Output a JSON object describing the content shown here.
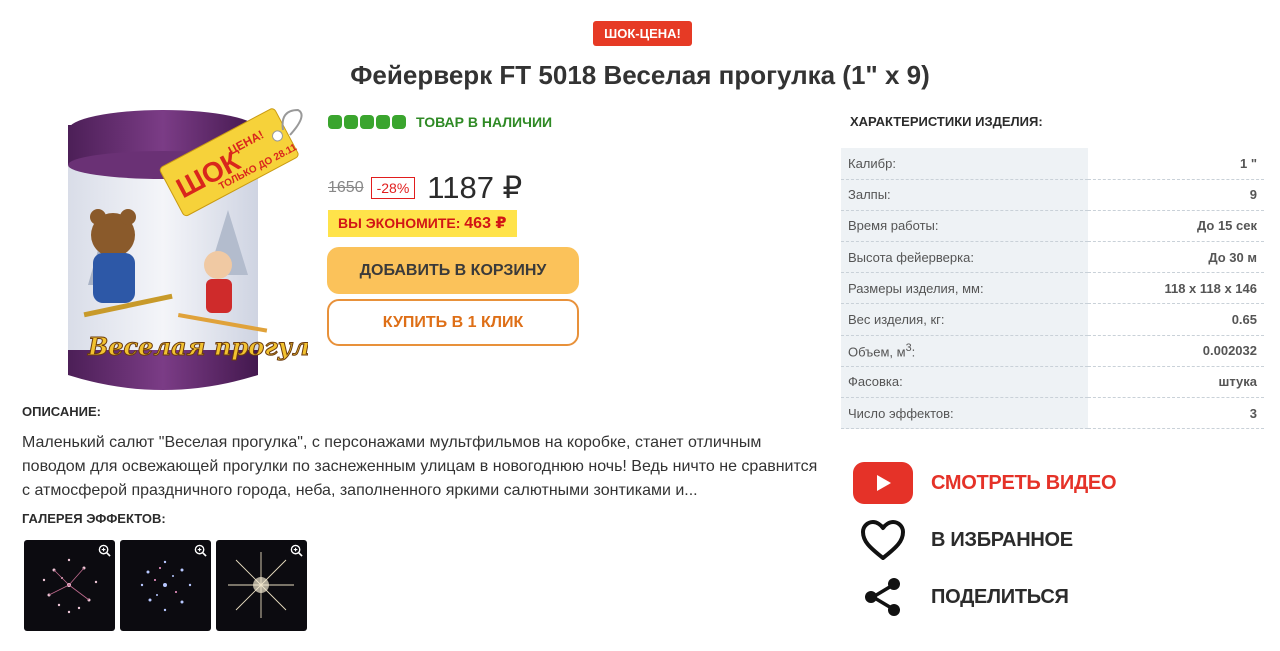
{
  "badge": "ШОК-ЦЕНА!",
  "product": {
    "title": "Фейерверк FT 5018 Веселая прогулка (1\" х 9)",
    "image_label": "Веселая прогулка",
    "image_tag_line1": "ШОК",
    "image_tag_line2": "ЦЕНА!",
    "image_tag_line3": "ТОЛЬКО ДО 28.11"
  },
  "stock": {
    "dots": 5,
    "label": "ТОВАР В НАЛИЧИИ",
    "color": "#3aa52e"
  },
  "pricing": {
    "old_price": "1650",
    "discount": "-28%",
    "price": "1187 ₽",
    "save_label": "ВЫ ЭКОНОМИТЕ:",
    "save_amount": "463 ₽"
  },
  "buttons": {
    "cart": "ДОБАВИТЬ В КОРЗИНУ",
    "buy_one_click": "КУПИТЬ В 1 КЛИК"
  },
  "description": {
    "heading": "ОПИСАНИЕ:",
    "text": "Маленький салют \"Веселая прогулка\", с персонажами мультфильмов на коробке, станет отличным поводом для освежающей прогулки по заснеженным улицам в новогоднюю ночь! Ведь ничто не сравнится с атмосферой праздничного города, неба, заполненного яркими салютными зонтиками и..."
  },
  "gallery": {
    "heading": "ГАЛЕРЕЯ ЭФФЕКТОВ:",
    "items": [
      "zoom-icon",
      "zoom-icon",
      "zoom-icon"
    ]
  },
  "specs": {
    "heading": "ХАРАКТЕРИСТИКИ ИЗДЕЛИЯ:",
    "rows": [
      {
        "key": "Калибр:",
        "value": "1 \""
      },
      {
        "key": "Залпы:",
        "value": "9"
      },
      {
        "key": "Время работы:",
        "value": "До 15 сек"
      },
      {
        "key": "Высота фейерверка:",
        "value": "До 30 м"
      },
      {
        "key": "Размеры изделия, мм:",
        "value": "118 х 118 х 146"
      },
      {
        "key": "Вес изделия, кг:",
        "value": "0.65"
      },
      {
        "key": "Объем, м",
        "sup": "3",
        "tail": ":",
        "value": "0.002032"
      },
      {
        "key": "Фасовка:",
        "value": "штука"
      },
      {
        "key": "Число эффектов:",
        "value": "3"
      }
    ]
  },
  "actions": {
    "video": "СМОТРЕТЬ ВИДЕО",
    "favorite": "В ИЗБРАННОЕ",
    "share": "ПОДЕЛИТЬСЯ"
  }
}
